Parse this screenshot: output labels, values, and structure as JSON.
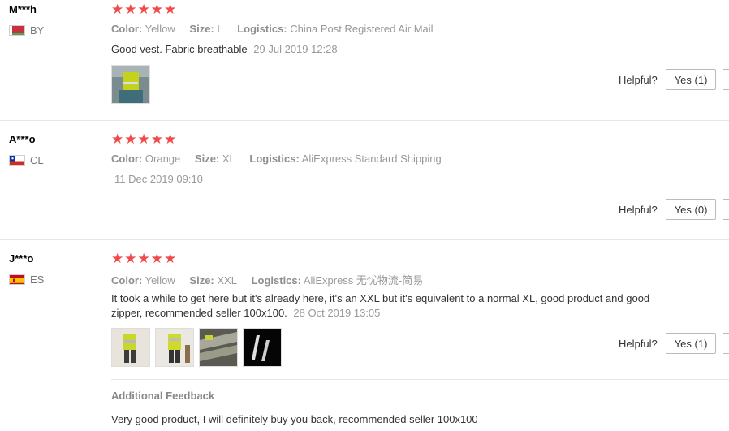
{
  "reviews": [
    {
      "user": "M***h",
      "country_code": "BY",
      "stars": "★★★★★",
      "color_label": "Color:",
      "color": "Yellow",
      "size_label": "Size:",
      "size": "L",
      "logistics_label": "Logistics:",
      "logistics": "China Post Registered Air Mail",
      "text": "Good vest. Fabric breathable",
      "date": "29 Jul 2019 12:28",
      "helpful_label": "Helpful?",
      "yes_label": "Yes (1)",
      "rating": 5
    },
    {
      "user": "A***o",
      "country_code": "CL",
      "stars": "★★★★★",
      "color_label": "Color:",
      "color": "Orange",
      "size_label": "Size:",
      "size": "XL",
      "logistics_label": "Logistics:",
      "logistics": "AliExpress Standard Shipping",
      "text": "",
      "date": "11 Dec 2019 09:10",
      "helpful_label": "Helpful?",
      "yes_label": "Yes (0)",
      "rating": 5
    },
    {
      "user": "J***o",
      "country_code": "ES",
      "stars": "★★★★★",
      "color_label": "Color:",
      "color": "Yellow",
      "size_label": "Size:",
      "size": "XXL",
      "logistics_label": "Logistics:",
      "logistics": "AliExpress 无忧物流-简易",
      "text": "It took a while to get here but it's already here, it's an XXL but it's equivalent to a normal XL, good product and good zipper, recommended seller 100x100.",
      "date": "28 Oct 2019 13:05",
      "helpful_label": "Helpful?",
      "yes_label": "Yes (1)",
      "rating": 5,
      "additional_title": "Additional Feedback",
      "additional_text": "Very good product, I will definitely buy you back, recommended seller 100x100"
    }
  ],
  "colors": {
    "star": "#f04b4b",
    "separator": "#e6e6e6",
    "muted": "#999999"
  }
}
